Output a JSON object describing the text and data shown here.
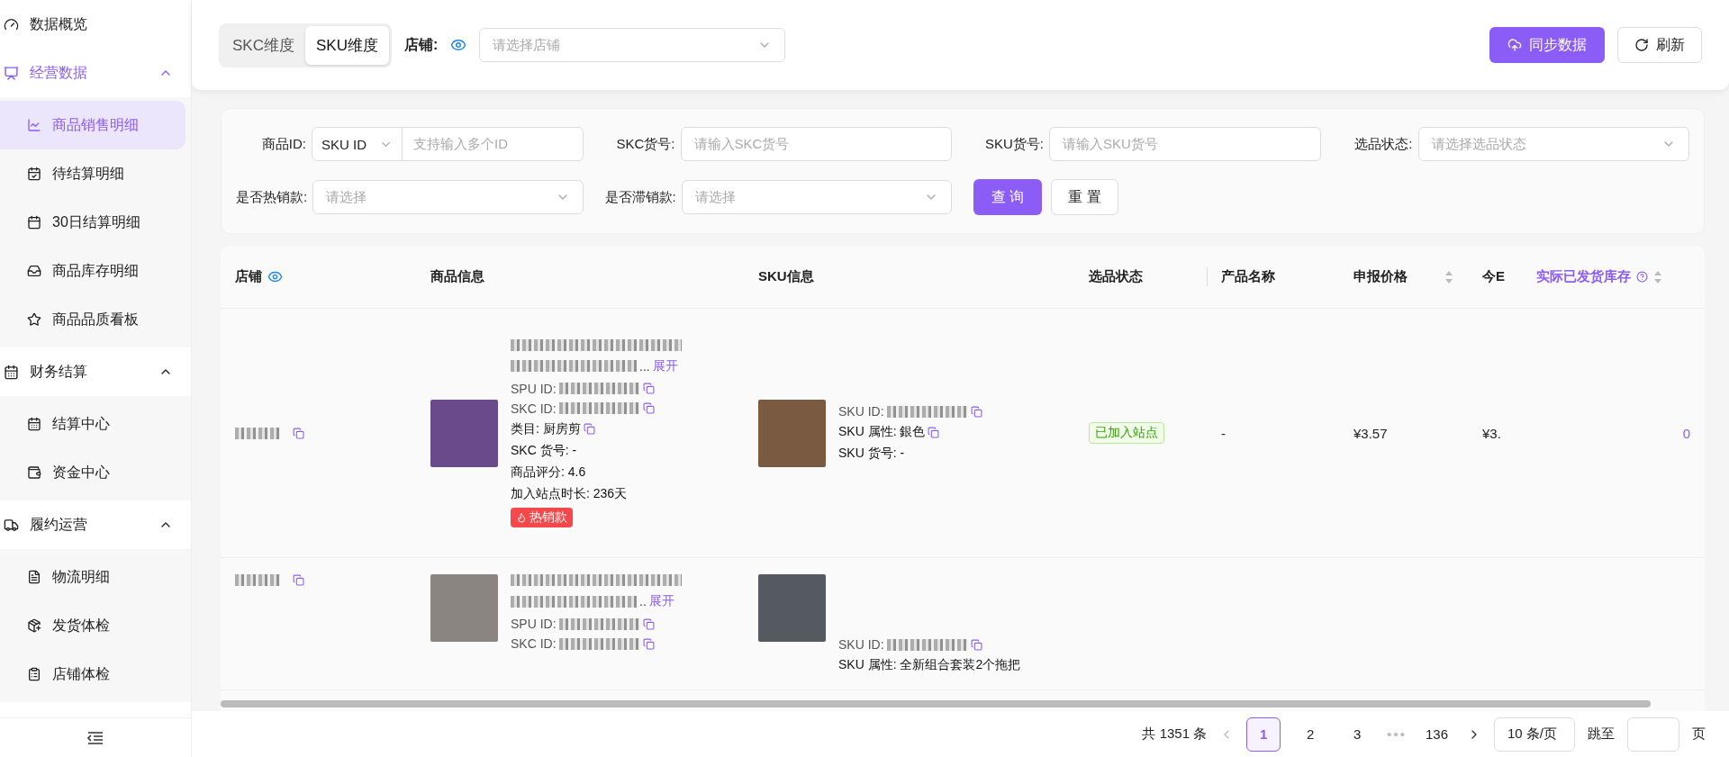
{
  "sidebar": {
    "items": [
      {
        "kind": "link",
        "label": "数据概览",
        "selected": false
      },
      {
        "kind": "group",
        "label": "经营数据",
        "selected": true,
        "expanded": true,
        "children": [
          {
            "label": "商品销售明细",
            "selected": true
          },
          {
            "label": "待结算明细",
            "selected": false
          },
          {
            "label": "30日结算明细",
            "selected": false
          },
          {
            "label": "商品库存明细",
            "selected": false
          },
          {
            "label": "商品品质看板",
            "selected": false
          }
        ]
      },
      {
        "kind": "group",
        "label": "财务结算",
        "selected": false,
        "expanded": true,
        "children": [
          {
            "label": "结算中心",
            "selected": false
          },
          {
            "label": "资金中心",
            "selected": false
          }
        ]
      },
      {
        "kind": "group",
        "label": "履约运营",
        "selected": false,
        "expanded": true,
        "children": [
          {
            "label": "物流明细",
            "selected": false
          },
          {
            "label": "发货体检",
            "selected": false
          },
          {
            "label": "店铺体检",
            "selected": false
          }
        ]
      }
    ]
  },
  "topbar": {
    "dimension_tabs": [
      {
        "label": "SKC维度",
        "selected": false
      },
      {
        "label": "SKU维度",
        "selected": true
      }
    ],
    "store_label": "店铺:",
    "store_select": {
      "placeholder": "请选择店铺"
    },
    "sync_button": "同步数据",
    "refresh_button": "刷新"
  },
  "filters": {
    "fields": [
      {
        "kind": "id_input",
        "label": "商品ID:",
        "select_value": "SKU ID",
        "placeholder": "支持输入多个ID"
      },
      {
        "kind": "input",
        "label": "SKC货号:",
        "placeholder": "请输入SKC货号"
      },
      {
        "kind": "input",
        "label": "SKU货号:",
        "placeholder": "请输入SKU货号"
      },
      {
        "kind": "select",
        "label": "选品状态:",
        "placeholder": "请选择选品状态"
      },
      {
        "kind": "select",
        "label": "是否热销款:",
        "placeholder": "请选择"
      },
      {
        "kind": "select",
        "label": "是否滞销款:",
        "placeholder": "请选择"
      }
    ],
    "search_button": "查 询",
    "reset_button": "重 置"
  },
  "table": {
    "columns": [
      {
        "label": "店铺",
        "kind": "eye"
      },
      {
        "label": "商品信息",
        "kind": "plain"
      },
      {
        "label": "SKU信息",
        "kind": "plain"
      },
      {
        "label": "选品状态",
        "kind": "plain"
      },
      {
        "label": "产品名称",
        "kind": "plain"
      },
      {
        "label": "申报价格",
        "kind": "sort"
      },
      {
        "label": "今E",
        "kind": "plain"
      },
      {
        "label": "实际已发货库存",
        "kind": "help_sort"
      }
    ],
    "rows": [
      {
        "product": {
          "ellipsis": "...",
          "expand": "展开",
          "fields": [
            {
              "label": "SPU ID:",
              "redacted": true,
              "copy": true
            },
            {
              "label": "SKC ID:",
              "redacted": true,
              "copy": true
            },
            {
              "text": "类目: 厨房剪",
              "copy": true
            },
            {
              "text": "SKC 货号: -",
              "copy": false
            },
            {
              "text": "商品评分: 4.6",
              "copy": false
            },
            {
              "text": "加入站点时长: 236天",
              "copy": false
            }
          ],
          "tag": "热销款"
        },
        "sku": {
          "fields": [
            {
              "label": "SKU ID:",
              "redacted": true,
              "copy": true
            },
            {
              "text": "SKU 属性: 銀色",
              "copy": true
            },
            {
              "text": "SKU 货号: -",
              "copy": false
            }
          ]
        },
        "status": "已加入站点",
        "name": "-",
        "price": "¥3.57",
        "today": "¥3.",
        "stock": "0"
      },
      {
        "product": {
          "ellipsis": "..",
          "expand": "展开",
          "fields": [
            {
              "label": "SPU ID:",
              "redacted": true,
              "copy": true
            },
            {
              "label": "SKC ID:",
              "redacted": true,
              "copy": true
            }
          ]
        },
        "sku": {
          "fields": [
            {
              "label": "SKU ID:",
              "redacted": true,
              "copy": true
            },
            {
              "text": "SKU 属性: 全新组合套装2个拖把",
              "copy": false
            }
          ]
        }
      }
    ]
  },
  "pagination": {
    "total": "共 1351 条",
    "pages": [
      {
        "label": "1",
        "kind": "page",
        "selected": true
      },
      {
        "label": "2",
        "kind": "page",
        "selected": false
      },
      {
        "label": "3",
        "kind": "page",
        "selected": false
      },
      {
        "label": "•••",
        "kind": "ellipsis",
        "selected": false
      },
      {
        "label": "136",
        "kind": "page",
        "selected": false
      }
    ],
    "page_size": "10 条/页",
    "jump_label": "跳至",
    "page_suffix": "页"
  }
}
